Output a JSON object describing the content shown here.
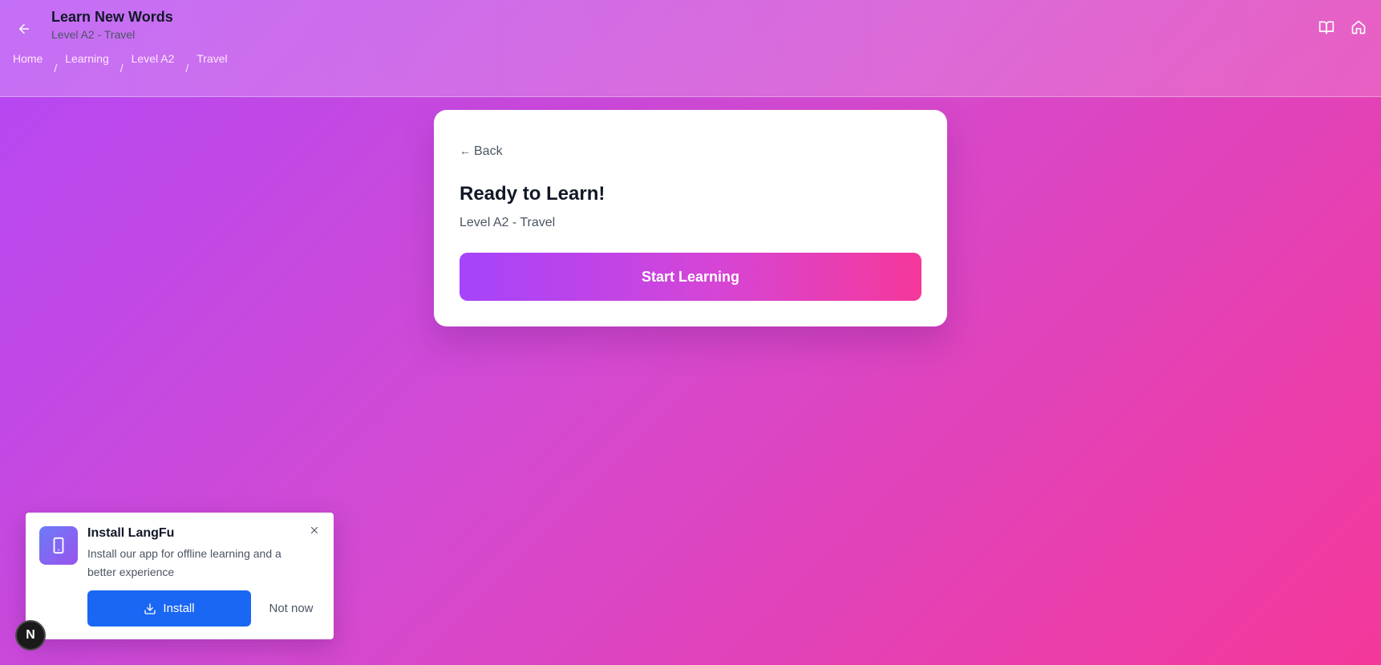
{
  "header": {
    "title": "Learn New Words",
    "subtitle": "Level A2 - Travel",
    "back_icon": "arrow-left-icon",
    "icons": [
      "book-open-icon",
      "home-icon"
    ]
  },
  "breadcrumb": {
    "items": [
      "Home",
      "Learning",
      "Level A2",
      "Travel"
    ],
    "separator": "/"
  },
  "card": {
    "back_arrow": "←",
    "back_label": "Back",
    "title": "Ready to Learn!",
    "subtitle": "Level A2 - Travel",
    "start_label": "Start Learning"
  },
  "install_prompt": {
    "title": "Install LangFu",
    "description": "Install our app for offline learning and a better experience",
    "install_label": "Install",
    "dismiss_label": "Not now",
    "icon": "smartphone-icon"
  },
  "dev_badge": {
    "label": "N"
  },
  "colors": {
    "gradient_start": "#b347f5",
    "gradient_end": "#f4389a",
    "install_button": "#1967f2"
  }
}
